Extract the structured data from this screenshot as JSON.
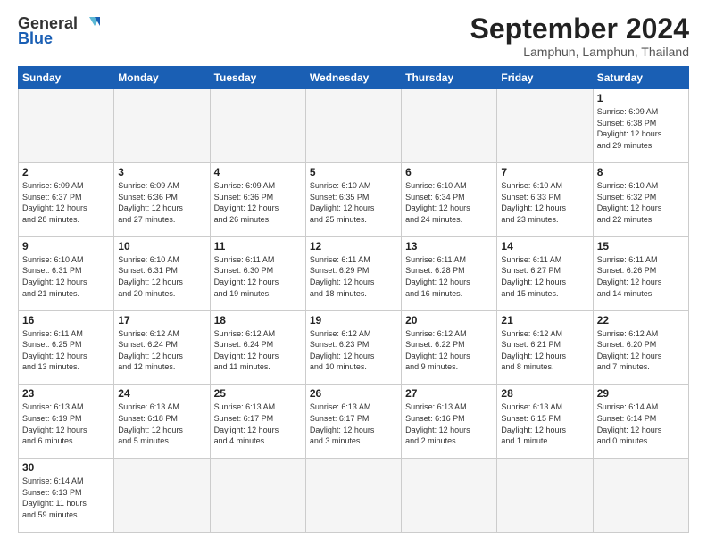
{
  "header": {
    "logo_line1": "General",
    "logo_line2": "Blue",
    "month_title": "September 2024",
    "location": "Lamphun, Lamphun, Thailand"
  },
  "weekdays": [
    "Sunday",
    "Monday",
    "Tuesday",
    "Wednesday",
    "Thursday",
    "Friday",
    "Saturday"
  ],
  "days": [
    {
      "num": "",
      "info": ""
    },
    {
      "num": "",
      "info": ""
    },
    {
      "num": "",
      "info": ""
    },
    {
      "num": "",
      "info": ""
    },
    {
      "num": "",
      "info": ""
    },
    {
      "num": "",
      "info": ""
    },
    {
      "num": "1",
      "info": "Sunrise: 6:09 AM\nSunset: 6:38 PM\nDaylight: 12 hours\nand 29 minutes."
    },
    {
      "num": "2",
      "info": "Sunrise: 6:09 AM\nSunset: 6:37 PM\nDaylight: 12 hours\nand 28 minutes."
    },
    {
      "num": "3",
      "info": "Sunrise: 6:09 AM\nSunset: 6:36 PM\nDaylight: 12 hours\nand 27 minutes."
    },
    {
      "num": "4",
      "info": "Sunrise: 6:09 AM\nSunset: 6:36 PM\nDaylight: 12 hours\nand 26 minutes."
    },
    {
      "num": "5",
      "info": "Sunrise: 6:10 AM\nSunset: 6:35 PM\nDaylight: 12 hours\nand 25 minutes."
    },
    {
      "num": "6",
      "info": "Sunrise: 6:10 AM\nSunset: 6:34 PM\nDaylight: 12 hours\nand 24 minutes."
    },
    {
      "num": "7",
      "info": "Sunrise: 6:10 AM\nSunset: 6:33 PM\nDaylight: 12 hours\nand 23 minutes."
    },
    {
      "num": "8",
      "info": "Sunrise: 6:10 AM\nSunset: 6:32 PM\nDaylight: 12 hours\nand 22 minutes."
    },
    {
      "num": "9",
      "info": "Sunrise: 6:10 AM\nSunset: 6:31 PM\nDaylight: 12 hours\nand 21 minutes."
    },
    {
      "num": "10",
      "info": "Sunrise: 6:10 AM\nSunset: 6:31 PM\nDaylight: 12 hours\nand 20 minutes."
    },
    {
      "num": "11",
      "info": "Sunrise: 6:11 AM\nSunset: 6:30 PM\nDaylight: 12 hours\nand 19 minutes."
    },
    {
      "num": "12",
      "info": "Sunrise: 6:11 AM\nSunset: 6:29 PM\nDaylight: 12 hours\nand 18 minutes."
    },
    {
      "num": "13",
      "info": "Sunrise: 6:11 AM\nSunset: 6:28 PM\nDaylight: 12 hours\nand 16 minutes."
    },
    {
      "num": "14",
      "info": "Sunrise: 6:11 AM\nSunset: 6:27 PM\nDaylight: 12 hours\nand 15 minutes."
    },
    {
      "num": "15",
      "info": "Sunrise: 6:11 AM\nSunset: 6:26 PM\nDaylight: 12 hours\nand 14 minutes."
    },
    {
      "num": "16",
      "info": "Sunrise: 6:11 AM\nSunset: 6:25 PM\nDaylight: 12 hours\nand 13 minutes."
    },
    {
      "num": "17",
      "info": "Sunrise: 6:12 AM\nSunset: 6:24 PM\nDaylight: 12 hours\nand 12 minutes."
    },
    {
      "num": "18",
      "info": "Sunrise: 6:12 AM\nSunset: 6:24 PM\nDaylight: 12 hours\nand 11 minutes."
    },
    {
      "num": "19",
      "info": "Sunrise: 6:12 AM\nSunset: 6:23 PM\nDaylight: 12 hours\nand 10 minutes."
    },
    {
      "num": "20",
      "info": "Sunrise: 6:12 AM\nSunset: 6:22 PM\nDaylight: 12 hours\nand 9 minutes."
    },
    {
      "num": "21",
      "info": "Sunrise: 6:12 AM\nSunset: 6:21 PM\nDaylight: 12 hours\nand 8 minutes."
    },
    {
      "num": "22",
      "info": "Sunrise: 6:12 AM\nSunset: 6:20 PM\nDaylight: 12 hours\nand 7 minutes."
    },
    {
      "num": "23",
      "info": "Sunrise: 6:13 AM\nSunset: 6:19 PM\nDaylight: 12 hours\nand 6 minutes."
    },
    {
      "num": "24",
      "info": "Sunrise: 6:13 AM\nSunset: 6:18 PM\nDaylight: 12 hours\nand 5 minutes."
    },
    {
      "num": "25",
      "info": "Sunrise: 6:13 AM\nSunset: 6:17 PM\nDaylight: 12 hours\nand 4 minutes."
    },
    {
      "num": "26",
      "info": "Sunrise: 6:13 AM\nSunset: 6:17 PM\nDaylight: 12 hours\nand 3 minutes."
    },
    {
      "num": "27",
      "info": "Sunrise: 6:13 AM\nSunset: 6:16 PM\nDaylight: 12 hours\nand 2 minutes."
    },
    {
      "num": "28",
      "info": "Sunrise: 6:13 AM\nSunset: 6:15 PM\nDaylight: 12 hours\nand 1 minute."
    },
    {
      "num": "29",
      "info": "Sunrise: 6:14 AM\nSunset: 6:14 PM\nDaylight: 12 hours\nand 0 minutes."
    },
    {
      "num": "30",
      "info": "Sunrise: 6:14 AM\nSunset: 6:13 PM\nDaylight: 11 hours\nand 59 minutes."
    },
    {
      "num": "",
      "info": ""
    },
    {
      "num": "",
      "info": ""
    },
    {
      "num": "",
      "info": ""
    },
    {
      "num": "",
      "info": ""
    },
    {
      "num": "",
      "info": ""
    }
  ]
}
